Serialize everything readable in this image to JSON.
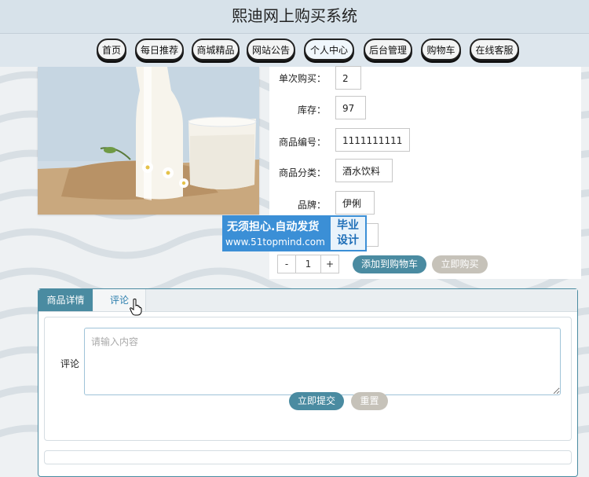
{
  "header": {
    "title": "熙迪网上购买系统"
  },
  "nav": {
    "items": [
      {
        "label": "首页"
      },
      {
        "label": "每日推荐"
      },
      {
        "label": "商城精品"
      },
      {
        "label": "网站公告"
      },
      {
        "label": "个人中心"
      },
      {
        "label": "后台管理"
      },
      {
        "label": "购物车"
      },
      {
        "label": "在线客服"
      }
    ]
  },
  "product": {
    "image_icon": "milk-product-photo",
    "fields": [
      {
        "label": "单次购买：",
        "value": "2"
      },
      {
        "label": "库存：",
        "value": "97"
      },
      {
        "label": "商品编号：",
        "value": "1111111111"
      },
      {
        "label": "商品分类：",
        "value": "酒水饮料"
      },
      {
        "label": "品牌：",
        "value": "伊俐"
      }
    ],
    "quantity": {
      "minus": "-",
      "value": "1",
      "plus": "+"
    },
    "add_to_cart": "添加到购物车",
    "buy_now": "立即购买"
  },
  "watermark": {
    "line1": "无须担心.自动发货",
    "line2": "www.51topmind.com",
    "badge_top": "毕业",
    "badge_bottom": "设计"
  },
  "details": {
    "tabs": [
      {
        "label": "商品详情"
      },
      {
        "label": "评论"
      }
    ],
    "comment_label": "评论",
    "comment_placeholder": "请输入内容",
    "submit": "立即提交",
    "reset": "重置"
  },
  "colors": {
    "accent": "#4a8ba1",
    "gray_button": "#c6c2b9",
    "header_bg": "#d7e2ea",
    "watermark_blue": "#3b8fd6"
  }
}
